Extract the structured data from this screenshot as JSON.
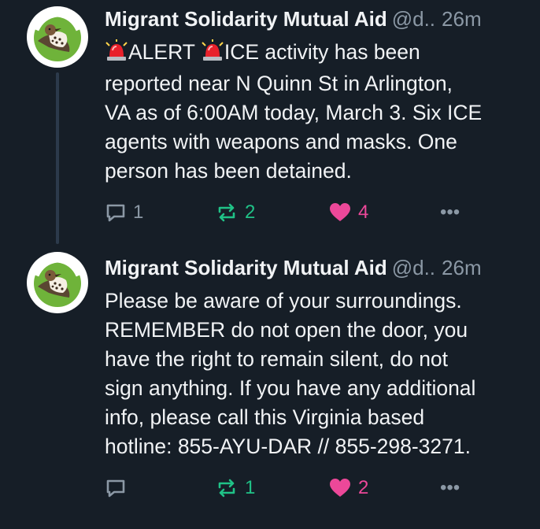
{
  "colors": {
    "background": "#161e27",
    "text": "#f1f3f5",
    "muted": "#8b98a5",
    "repost": "#20c287",
    "like": "#ec4899",
    "avatar_green": "#6fb33a"
  },
  "posts": [
    {
      "author": "Migrant Solidarity Mutual Aid",
      "handle": "@d..",
      "time": "26m",
      "avatar_text": "MIGRANT SOLIDARITY MUTUAL AID",
      "lines": [
        {
          "siren1": "rotating-light-emoji",
          "a": "ALERT ",
          "siren2": "rotating-light-emoji",
          "b": "ICE activity has been"
        },
        "reported near N Quinn St in Arlington,",
        "VA as of 6:00AM today, March 3. Six ICE",
        "agents with weapons and masks. One",
        "person has been detained."
      ],
      "actions": {
        "replies": "1",
        "reposts": "2",
        "likes": "4",
        "more": "•••"
      }
    },
    {
      "author": "Migrant Solidarity Mutual Aid",
      "handle": "@d..",
      "time": "26m",
      "avatar_text": "MIGRANT SOLIDARITY MUTUAL AID",
      "lines": [
        "Please be aware of your surroundings.",
        "REMEMBER do not open the door, you",
        "have the right to remain silent, do not",
        "sign anything. If you have any additional",
        "info, please call this Virginia based",
        "hotline: 855-AYU-DAR // 855-298-3271."
      ],
      "actions": {
        "replies": "",
        "reposts": "1",
        "likes": "2",
        "more": "•••"
      }
    }
  ]
}
